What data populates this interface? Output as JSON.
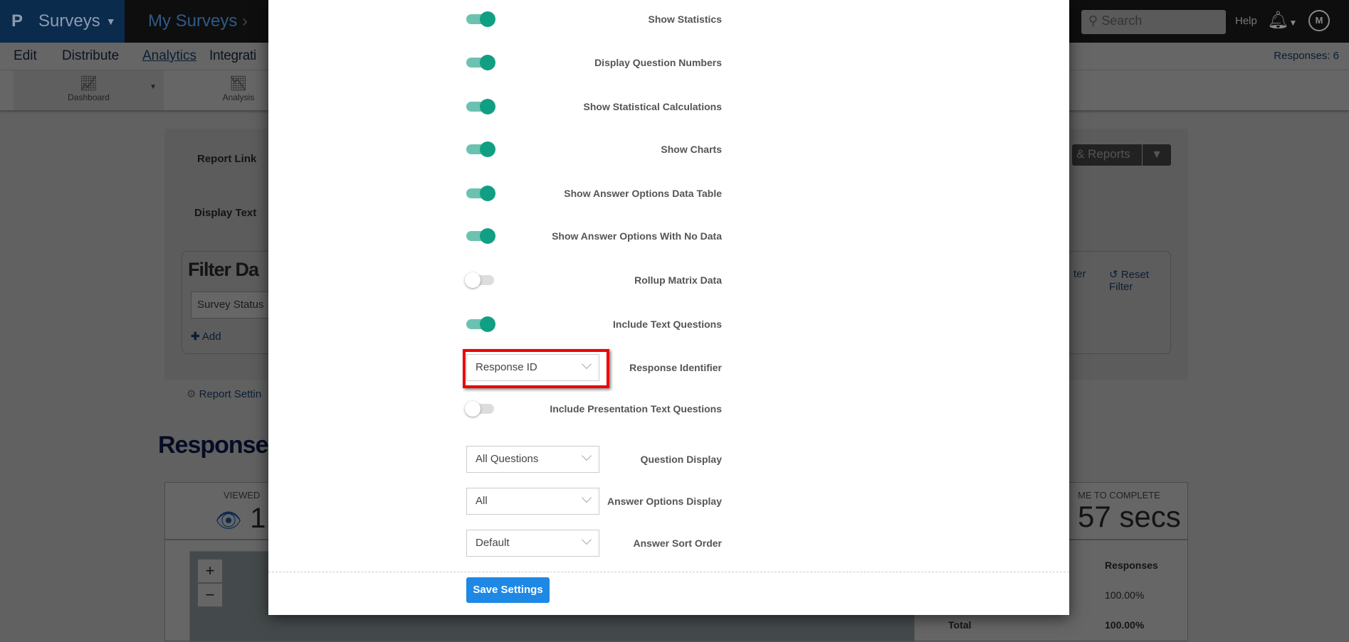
{
  "header": {
    "logo": "P",
    "app": "Surveys",
    "breadcrumb": "My Surveys",
    "search_placeholder": "Search",
    "help": "Help",
    "avatar": "M"
  },
  "nav": {
    "items": [
      "Edit",
      "Distribute",
      "Analytics",
      "Integrati"
    ],
    "active": "Analytics",
    "responses": "Responses: 6"
  },
  "toolbar": {
    "dashboard": "Dashboard",
    "analysis": "Analysis"
  },
  "panel": {
    "report_link": "Report Link",
    "display_text": "Display Text",
    "reports_button": "& Reports",
    "filter_title": "Filter Da",
    "survey_status": "Survey Status",
    "add": "Add",
    "filter_partial": "ter",
    "reset_filter": "Reset Filter",
    "report_settings": "Report Settin"
  },
  "responses": {
    "heading": "Response",
    "viewed_label": "VIEWED",
    "viewed_value": "1",
    "time_label": "ME TO COMPLETE",
    "time_value": "57 secs",
    "zoom_in": "+",
    "zoom_out": "−",
    "table": {
      "header": "Responses",
      "row": "100.00%",
      "total_label": "Total",
      "total": "100.00%"
    }
  },
  "modal": {
    "toggles": [
      {
        "label": "Show Statistics",
        "on": true
      },
      {
        "label": "Display Question Numbers",
        "on": true
      },
      {
        "label": "Show Statistical Calculations",
        "on": true
      },
      {
        "label": "Show Charts",
        "on": true
      },
      {
        "label": "Show Answer Options Data Table",
        "on": true
      },
      {
        "label": "Show Answer Options With No Data",
        "on": true
      },
      {
        "label": "Rollup Matrix Data",
        "on": false
      },
      {
        "label": "Include Text Questions",
        "on": true
      }
    ],
    "response_identifier": {
      "label": "Response Identifier",
      "value": "Response ID"
    },
    "presentation": {
      "label": "Include Presentation Text Questions",
      "on": false
    },
    "question_display": {
      "label": "Question Display",
      "value": "All Questions"
    },
    "answer_options_display": {
      "label": "Answer Options Display",
      "value": "All"
    },
    "answer_sort_order": {
      "label": "Answer Sort Order",
      "value": "Default"
    },
    "save": "Save Settings"
  },
  "colors": {
    "toggle_on": "#119f83",
    "save": "#1e88e5",
    "highlight": "#ee0000",
    "brand": "#1b6bc0"
  }
}
